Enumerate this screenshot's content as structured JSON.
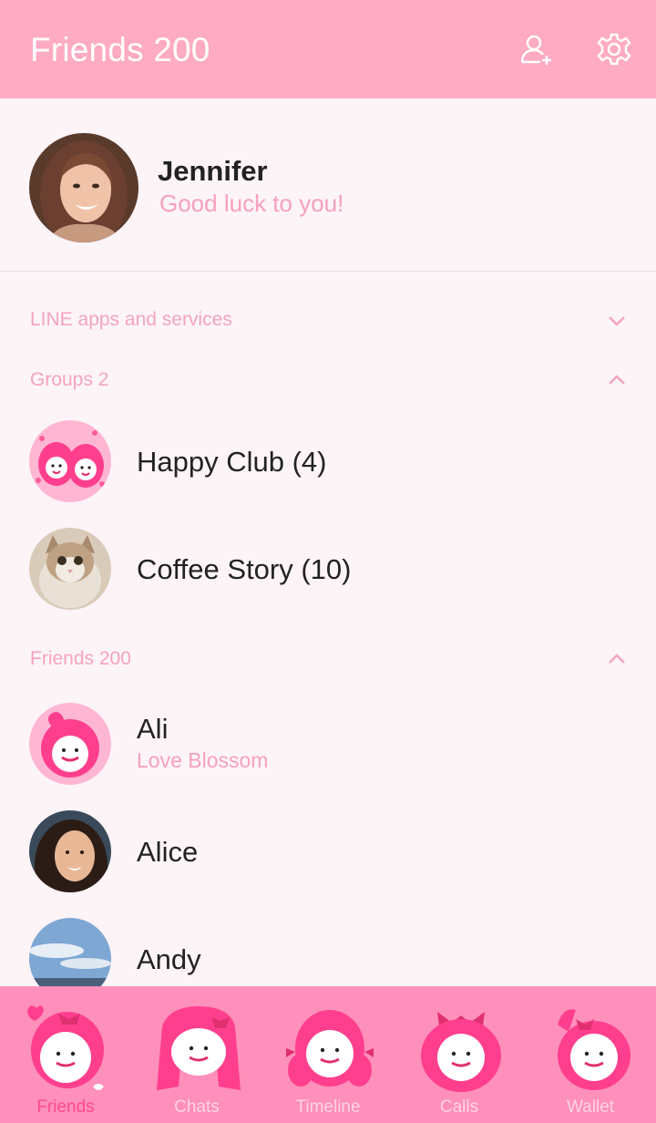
{
  "header": {
    "title": "Friends 200"
  },
  "profile": {
    "name": "Jennifer",
    "status": "Good luck to you!"
  },
  "sections": {
    "line_apps": "LINE apps and services",
    "groups": "Groups 2",
    "friends": "Friends 200"
  },
  "groups": [
    {
      "name": "Happy Club (4)"
    },
    {
      "name": "Coffee Story (10)"
    }
  ],
  "friends": [
    {
      "name": "Ali",
      "status": "Love Blossom"
    },
    {
      "name": "Alice",
      "status": ""
    },
    {
      "name": "Andy",
      "status": ""
    }
  ],
  "tabs": [
    "Friends",
    "Chats",
    "Timeline",
    "Calls",
    "Wallet"
  ],
  "colors": {
    "header": "#ffabc4",
    "accent": "#f6a0bf",
    "tabbar": "#ff8fbb",
    "active_tab": "#ff4a8f"
  }
}
